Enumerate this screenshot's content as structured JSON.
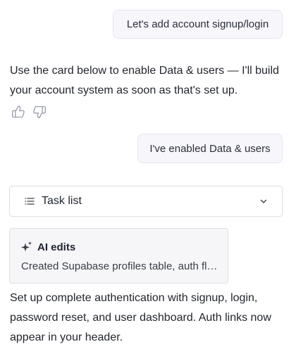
{
  "messages": {
    "user_1": "Let's add account signup/login",
    "assistant_1": "Use the card below to enable Data & users — I'll build your account system as soon as that's set up.",
    "user_2": "I've enabled Data & users",
    "assistant_2": "Set up complete authentication with signup, login, password reset, and user dashboard. Auth links now appear in your header."
  },
  "task_list": {
    "label": "Task list",
    "icon": "list-icon",
    "expand_icon": "chevron-down-icon"
  },
  "ai_edits": {
    "title": "AI edits",
    "description": "Created Supabase profiles table, auth flow, pages and header links",
    "icon": "sparkle-icon"
  },
  "feedback": {
    "icons": [
      "thumbs-up-icon",
      "thumbs-down-icon"
    ]
  },
  "colors": {
    "bubble_bg": "#f7f6fb",
    "bubble_border": "#e6e4ef",
    "card_bg": "#f6f6f8",
    "text": "#23262e"
  }
}
